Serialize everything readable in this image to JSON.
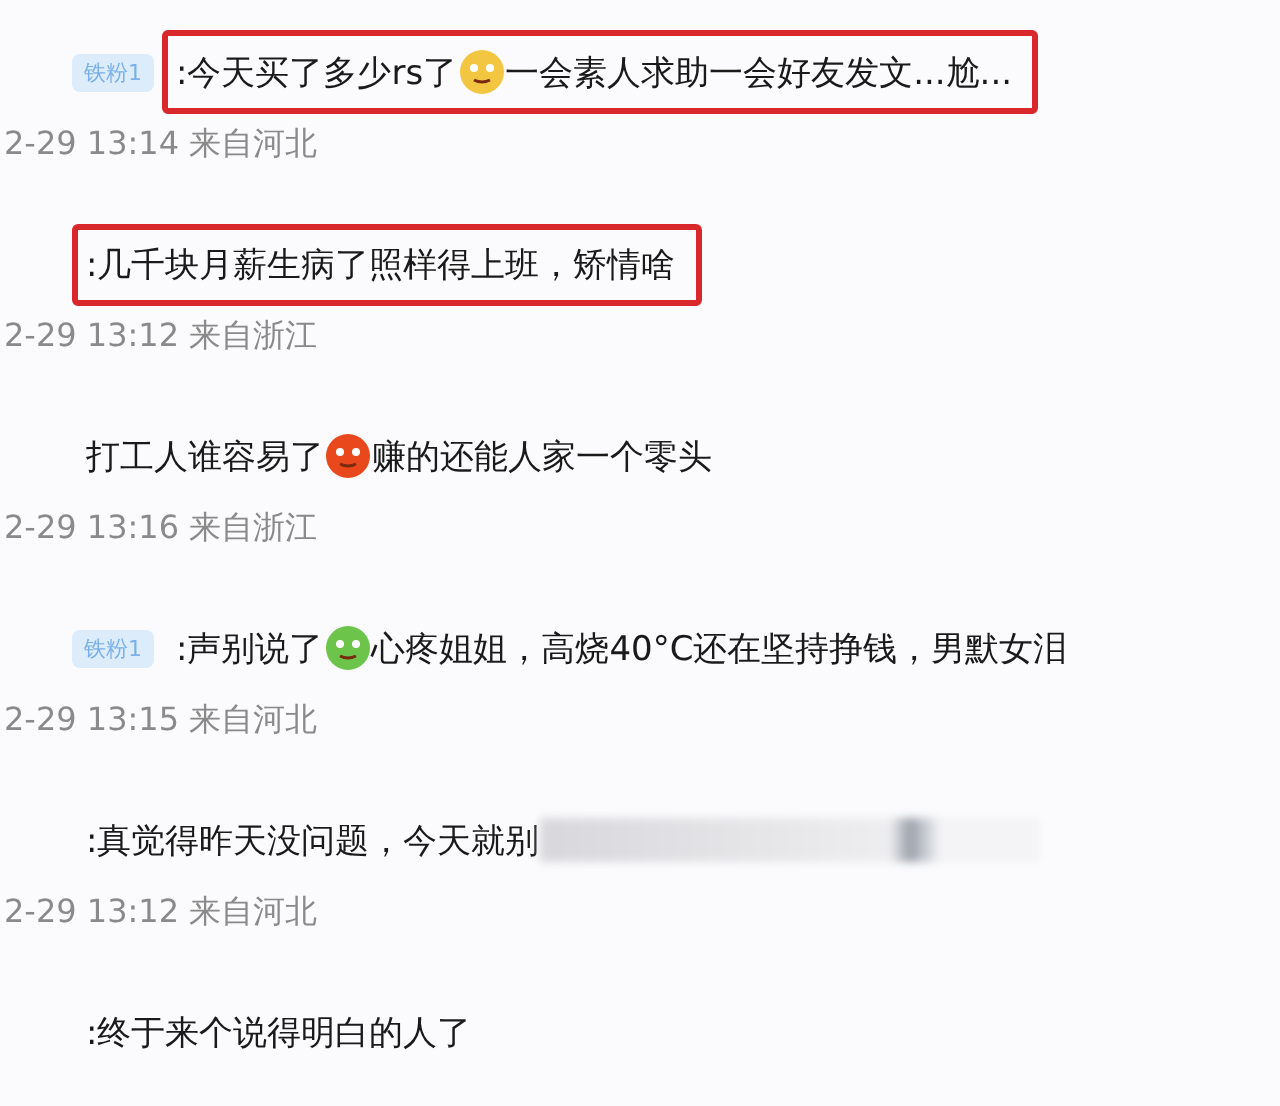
{
  "comments": [
    {
      "badge": "铁粉1",
      "highlighted": true,
      "parts": [
        {
          "kind": "text",
          "text": ":今天买了多少rs了"
        },
        {
          "kind": "emoji",
          "color": "#f2c640"
        },
        {
          "kind": "text",
          "text": "一会素人求助一会好友发文...尬..."
        }
      ],
      "meta": "2-29 13:14 来自河北"
    },
    {
      "highlighted": true,
      "parts": [
        {
          "kind": "text",
          "text": ":几千块月薪生病了照样得上班，矫情啥"
        }
      ],
      "meta": "2-29 13:12 来自浙江"
    },
    {
      "highlighted": false,
      "parts": [
        {
          "kind": "text",
          "text": "打工人谁容易了"
        },
        {
          "kind": "emoji",
          "color": "#e8481c"
        },
        {
          "kind": "text",
          "text": "赚的还能人家一个零头"
        }
      ],
      "meta": "2-29 13:16 来自浙江"
    },
    {
      "badge": "铁粉1",
      "highlighted": false,
      "parts": [
        {
          "kind": "text",
          "text": ":声别说了"
        },
        {
          "kind": "emoji",
          "color": "#6cc44a"
        },
        {
          "kind": "text",
          "text": "心疼姐姐，高烧40°C还在坚持挣钱，男默女泪"
        }
      ],
      "meta": "2-29 13:15 来自河北"
    },
    {
      "highlighted": false,
      "blurred_tail": true,
      "parts": [
        {
          "kind": "text",
          "text": ":真觉得昨天没问题，今天就别"
        }
      ],
      "meta": "2-29 13:12 来自河北"
    },
    {
      "highlighted": false,
      "parts": [
        {
          "kind": "text",
          "text": ":终于来个说得明白的人了"
        }
      ]
    }
  ]
}
